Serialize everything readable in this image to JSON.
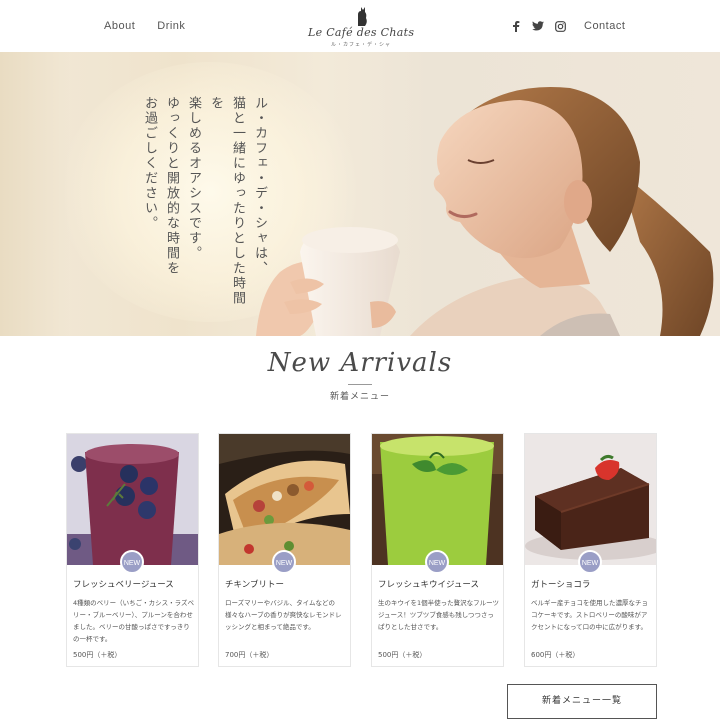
{
  "header": {
    "nav_left": [
      "About",
      "Drink"
    ],
    "logo_text": "Le Café des Chats",
    "logo_sub": "ル・カフェ・デ・シャ",
    "social_icons": [
      "facebook-icon",
      "twitter-icon",
      "instagram-icon"
    ],
    "contact_label": "Contact"
  },
  "hero": {
    "copy": "ル・カフェ・デ・シャは、\n猫と一緒にゆったりとした時間を\n楽しめるオアシスです。\nゆっくりと開放的な時間を\nお過ごしください。"
  },
  "section": {
    "title": "New Arrivals",
    "subtitle": "新着メニュー"
  },
  "cards": [
    {
      "badge": "NEW",
      "title": "フレッシュベリージュース",
      "desc": "4種類のベリー（いちご・カシス・ラズベリー・ブルーベリー）、プルーンを合わせました。ベリーの甘酸っぱさですっきりの一杯です。",
      "price": "500円（＋税）"
    },
    {
      "badge": "NEW",
      "title": "チキンブリトー",
      "desc": "ローズマリーやバジル、タイムなどの様々なハーブの香りが爽快なレモンドレッシングと相まって絶品です。",
      "price": "700円（＋税）"
    },
    {
      "badge": "NEW",
      "title": "フレッシュキウイジュース",
      "desc": "生のキウイを1個半使った贅沢なフルーツジュース！ツブツブ食感も残しつつさっぱりとした甘さです。",
      "price": "500円（＋税）"
    },
    {
      "badge": "NEW",
      "title": "ガトーショコラ",
      "desc": "ベルギー産チョコを使用した濃厚なチョコケーキです。ストロベリーの酸味がアクセントになって口の中に広がります。",
      "price": "600円（＋税）"
    }
  ],
  "more_button": "新着メニュー一覧",
  "colors": {
    "badge": "#9a9ec6",
    "text": "#444444",
    "hero_bg": "#f2e9d8"
  }
}
